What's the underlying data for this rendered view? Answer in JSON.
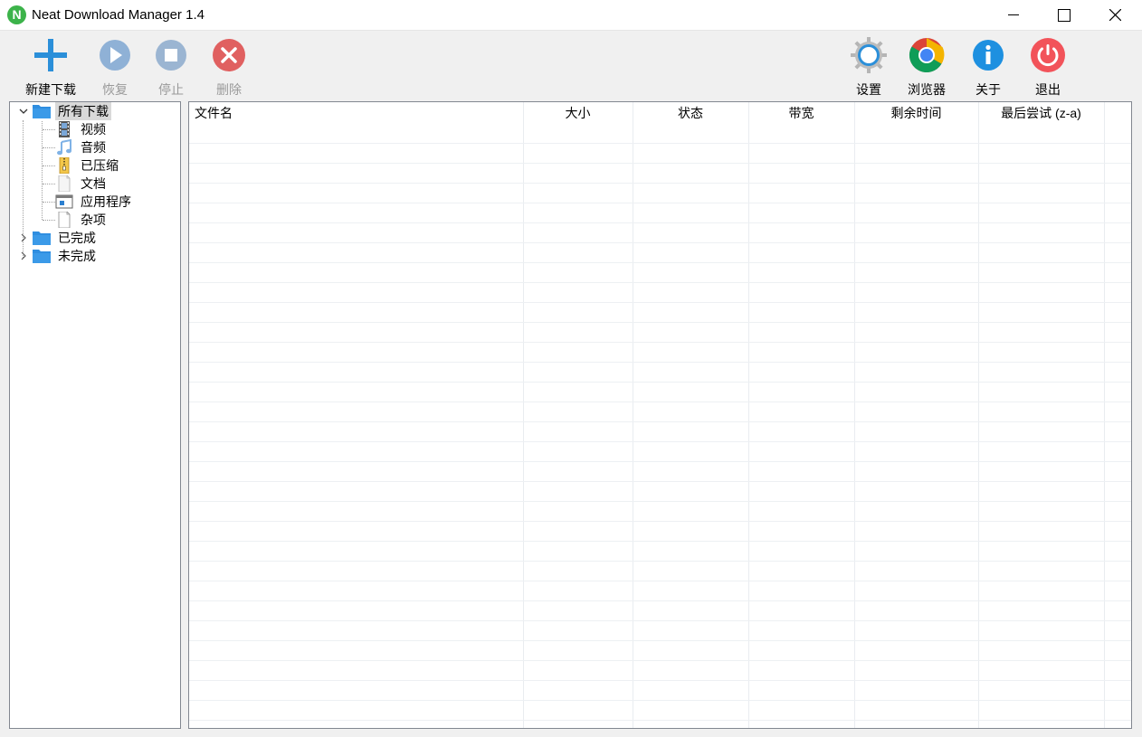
{
  "window": {
    "title": "Neat Download Manager 1.4",
    "app_icon_letter": "N"
  },
  "toolbar": {
    "new_download": "新建下载",
    "resume": "恢复",
    "stop": "停止",
    "delete": "删除",
    "settings": "设置",
    "browser": "浏览器",
    "about": "关于",
    "exit": "退出"
  },
  "tree": {
    "all_downloads": "所有下载",
    "children": [
      "视频",
      "音频",
      "已压缩",
      "文档",
      "应用程序",
      "杂项"
    ],
    "completed": "已完成",
    "incomplete": "未完成"
  },
  "list": {
    "columns": [
      "文件名",
      "大小",
      "状态",
      "带宽",
      "剩余时间",
      "最后尝试 (z-a)"
    ]
  },
  "colors": {
    "accent_blue": "#2b8fd9",
    "folder_blue": "#2f8ee0",
    "delete_red": "#e06060",
    "exit_red": "#f2535a"
  }
}
